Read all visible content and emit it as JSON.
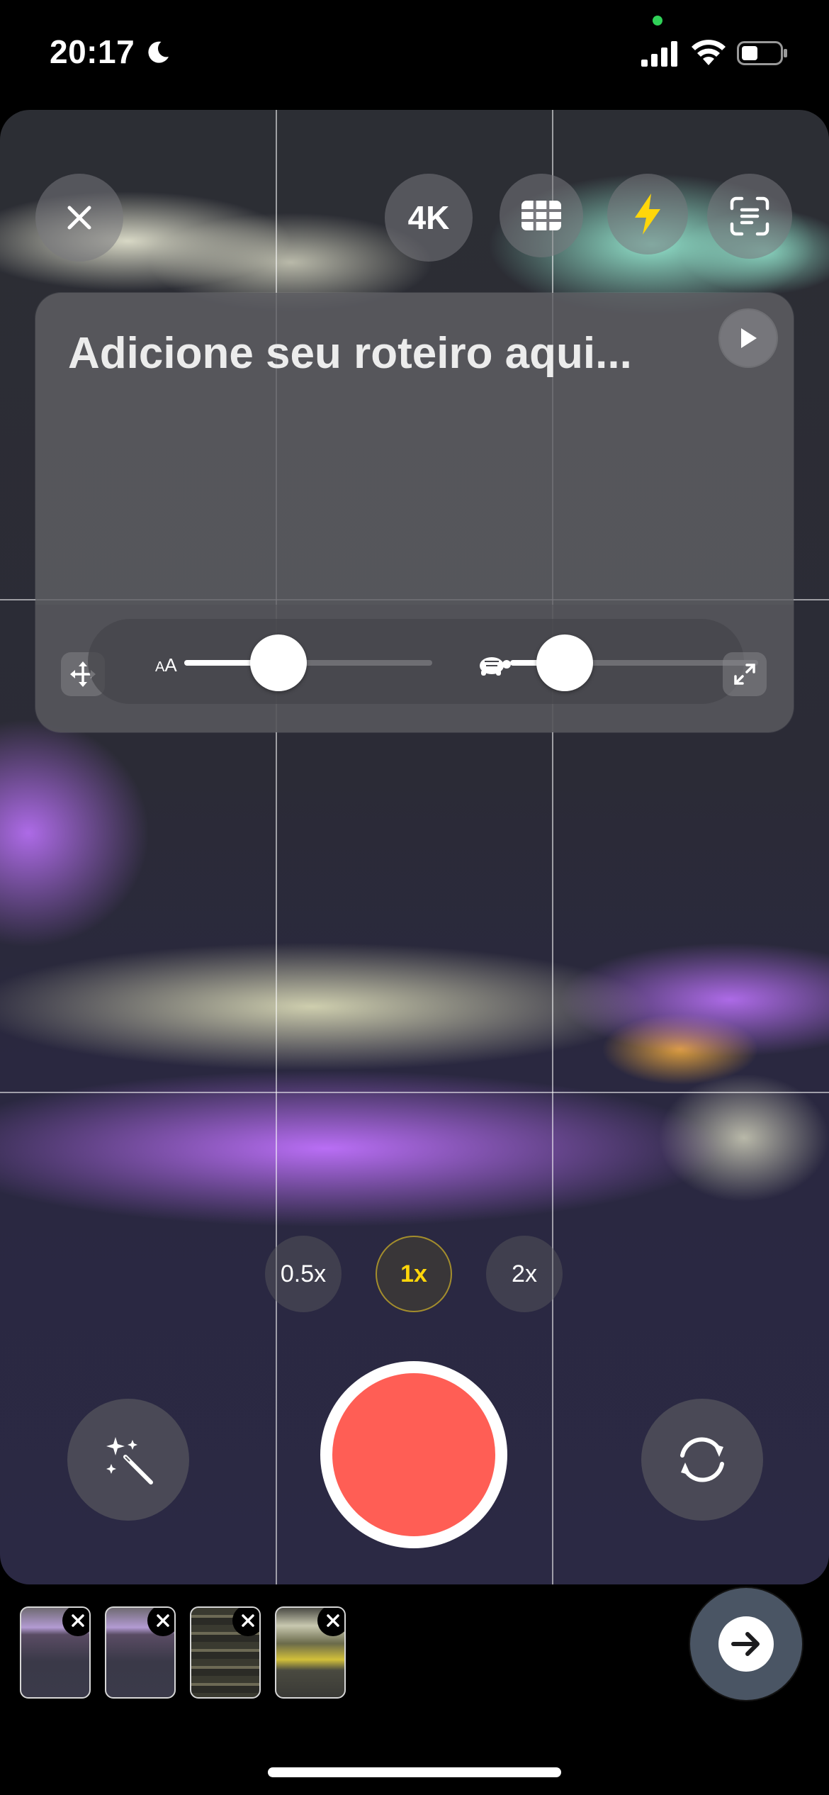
{
  "status_bar": {
    "time": "20:17",
    "icons": [
      "moon-icon",
      "cellular-signal-icon",
      "wifi-icon",
      "battery-icon"
    ],
    "camera_in_use_indicator_color": "#30d158"
  },
  "top_controls": {
    "close_icon": "close-icon",
    "resolution_label": "4K",
    "grid_icon": "grid-icon",
    "flash_icon": "flash-icon",
    "flash_color": "#ffd60a",
    "scan_icon": "text-scan-icon"
  },
  "teleprompter": {
    "script_placeholder": "Adicione seu roteiro aqui...",
    "font_size_label_small": "A",
    "font_size_label_large": "A",
    "font_size_level": 0.38,
    "speed_level": 0.22,
    "speed_icon": "turtle-icon"
  },
  "zoom": {
    "options": [
      "0.5x",
      "1x",
      "2x"
    ],
    "selected": "1x"
  },
  "bottom_controls": {
    "effects_icon": "magic-wand-icon",
    "record_color": "#ff5e55",
    "flip_icon": "camera-flip-icon"
  },
  "clips": {
    "count": 4,
    "remove_icon": "close-icon"
  },
  "next_icon": "arrow-right-icon"
}
